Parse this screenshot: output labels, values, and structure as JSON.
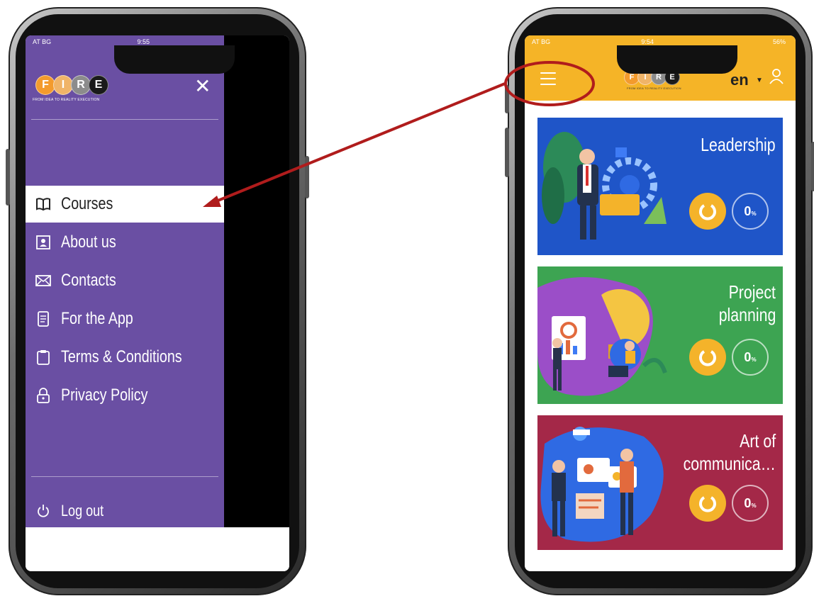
{
  "left_phone": {
    "status": {
      "left": "AT BG",
      "time": "9:55"
    },
    "logo": {
      "letters": [
        "F",
        "I",
        "R",
        "E"
      ],
      "tagline": "FROM IDEA TO REALITY EXECUTION"
    },
    "close_icon": "close-icon",
    "menu_items": [
      {
        "label": "Courses",
        "icon": "book-icon",
        "active": true
      },
      {
        "label": "About us",
        "icon": "person-card-icon",
        "active": false
      },
      {
        "label": "Contacts",
        "icon": "envelope-icon",
        "active": false
      },
      {
        "label": "For the App",
        "icon": "phone-doc-icon",
        "active": false
      },
      {
        "label": "Terms & Conditions",
        "icon": "clipboard-icon",
        "active": false
      },
      {
        "label": "Privacy Policy",
        "icon": "lock-icon",
        "active": false
      }
    ],
    "logout": {
      "label": "Log out",
      "icon": "power-icon"
    },
    "colors": {
      "panel": "#6a4fa3",
      "overlay": "#000000"
    }
  },
  "right_phone": {
    "status": {
      "left": "AT BG",
      "time": "9:54",
      "battery": "56%"
    },
    "logo": {
      "letters": [
        "F",
        "I",
        "R",
        "E"
      ],
      "tagline": "FROM IDEA TO REALITY EXECUTION"
    },
    "language": "en",
    "courses": [
      {
        "title": "Leadership",
        "progress": "0",
        "unit": "%",
        "color": "#1f55c8"
      },
      {
        "title_lines": [
          "Project",
          "planning"
        ],
        "progress": "0",
        "unit": "%",
        "color": "#3da452"
      },
      {
        "title_lines": [
          "Art of",
          "communica…"
        ],
        "progress": "0",
        "unit": "%",
        "color": "#a42848"
      }
    ],
    "colors": {
      "topbar": "#f5b427"
    }
  },
  "annotation": {
    "highlight_color": "#b01c1c"
  }
}
